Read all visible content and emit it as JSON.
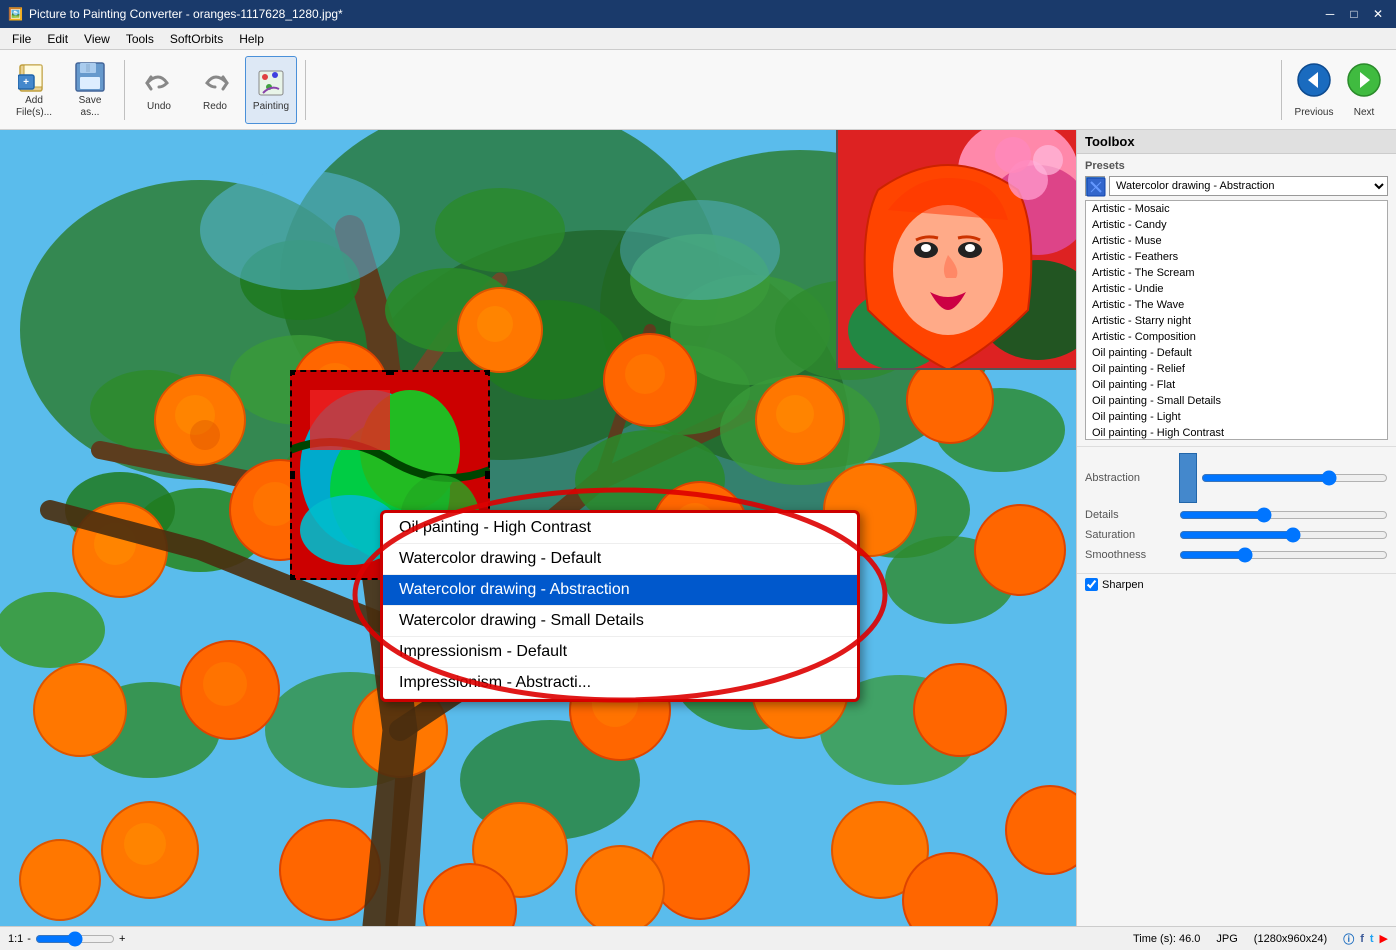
{
  "app": {
    "title": "Picture to Painting Converter - oranges-1117628_1280.jpg*",
    "icon": "🖼️"
  },
  "titlebar": {
    "minimize": "─",
    "maximize": "□",
    "close": "✕"
  },
  "menu": {
    "items": [
      "File",
      "Edit",
      "View",
      "Tools",
      "SoftOrbits",
      "Help"
    ]
  },
  "toolbar": {
    "buttons": [
      {
        "id": "add-file",
        "label": "Add\nFile(s)...",
        "icon": "📂"
      },
      {
        "id": "save-as",
        "label": "Save\nas...",
        "icon": "💾"
      },
      {
        "id": "undo",
        "label": "Undo",
        "icon": "↩"
      },
      {
        "id": "redo",
        "label": "Redo",
        "icon": "↪"
      },
      {
        "id": "painting",
        "label": "Painting",
        "icon": "🖌️"
      }
    ],
    "previous_label": "Previous",
    "next_label": "Next"
  },
  "toolbox": {
    "header": "Toolbox",
    "presets_label": "Presets",
    "selected_preset": "Watercolor drawing - Abstractio",
    "preset_list": [
      "Artistic - Mosaic",
      "Artistic - Candy",
      "Artistic - Muse",
      "Artistic - Feathers",
      "Artistic - The Scream",
      "Artistic - Undie",
      "Artistic - The Wave",
      "Artistic - Starry night",
      "Artistic - Composition",
      "Oil painting - Default",
      "Oil painting - Relief",
      "Oil painting - Flat",
      "Oil painting - Small Details",
      "Oil painting - Light",
      "Oil painting - High Contrast",
      "Watercolor drawing - Default",
      "Watercolor drawing - Abstraction",
      "Watercolor drawing - Small Details"
    ],
    "sections": [
      {
        "id": "abstraction",
        "label": "Abstraction"
      },
      {
        "id": "details",
        "label": "Details"
      },
      {
        "id": "saturation",
        "label": "Saturation"
      },
      {
        "id": "smoothness",
        "label": "Smoothness"
      }
    ],
    "sliders": [
      {
        "id": "abstraction",
        "label": "Abstraction",
        "value": 70
      },
      {
        "id": "details",
        "label": "Details",
        "value": 40
      },
      {
        "id": "saturation",
        "label": "Saturation",
        "value": 55
      },
      {
        "id": "smoothness",
        "label": "Smoothness",
        "value": 30
      }
    ],
    "checkbox_label": "Sharpen",
    "checkbox_checked": true
  },
  "large_dropdown": {
    "items": [
      {
        "id": "oil-high-contrast",
        "label": "Oil painting - High Contrast",
        "selected": false
      },
      {
        "id": "watercolor-default",
        "label": "Watercolor drawing - Default",
        "selected": false
      },
      {
        "id": "watercolor-abstraction",
        "label": "Watercolor drawing - Abstraction",
        "selected": true
      },
      {
        "id": "watercolor-small",
        "label": "Watercolor drawing - Small Details",
        "selected": false
      },
      {
        "id": "impressionism-default",
        "label": "Impressionism - Default",
        "selected": false
      },
      {
        "id": "impressionism-abstraction",
        "label": "Impressionism - Abstracti...",
        "selected": false
      }
    ]
  },
  "status": {
    "zoom_label": "1:1",
    "time_label": "Time (s): 46.0",
    "format_label": "JPG",
    "dimensions_label": "(1280x960x24)"
  }
}
